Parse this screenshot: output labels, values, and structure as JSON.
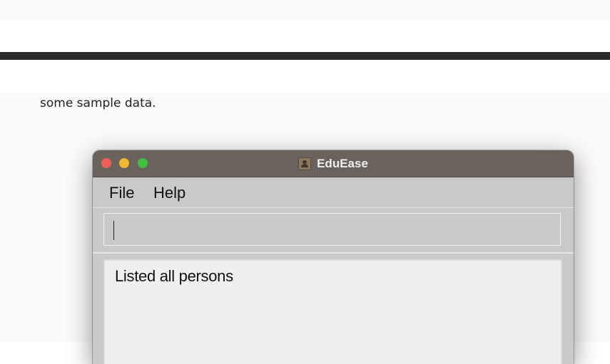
{
  "document": {
    "text": "some sample data."
  },
  "window": {
    "title": "EduEase",
    "icon": "app-icon"
  },
  "menu": {
    "items": [
      {
        "label": "File"
      },
      {
        "label": "Help"
      }
    ]
  },
  "command_box": {
    "value": ""
  },
  "result_display": {
    "text": "Listed all persons"
  },
  "colors": {
    "title_bar": "#6a625d",
    "window_bg": "#c9c9c9",
    "result_bg": "#efefef",
    "close": "#ee5e56",
    "minimize": "#f2b834",
    "maximize": "#3fc041"
  }
}
